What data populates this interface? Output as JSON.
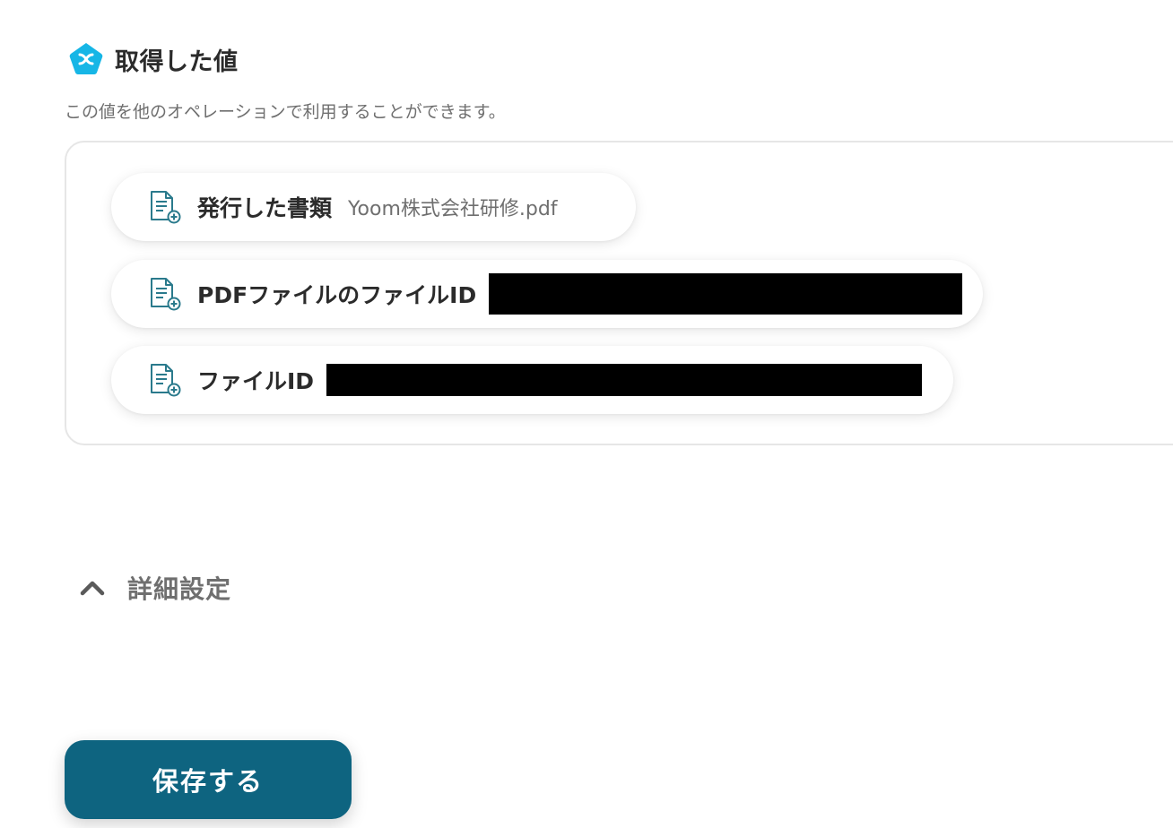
{
  "section": {
    "title": "取得した値",
    "description": "この値を他のオペレーションで利用することができます。",
    "icon": "yoom-x-badge-icon",
    "accent_color": "#16b6e6"
  },
  "values": [
    {
      "label": "発行した書類",
      "value": "Yoom株式会社研修.pdf",
      "icon": "document-plus-icon"
    },
    {
      "label": "PDFファイルのファイルID",
      "value": "",
      "icon": "document-plus-icon"
    },
    {
      "label": "ファイルID",
      "value": "",
      "icon": "document-plus-icon"
    }
  ],
  "advanced_settings": {
    "label": "詳細設定",
    "icon": "chevron-up-icon",
    "expanded": true
  },
  "save_button": {
    "label": "保存する",
    "color": "#0e6480"
  }
}
